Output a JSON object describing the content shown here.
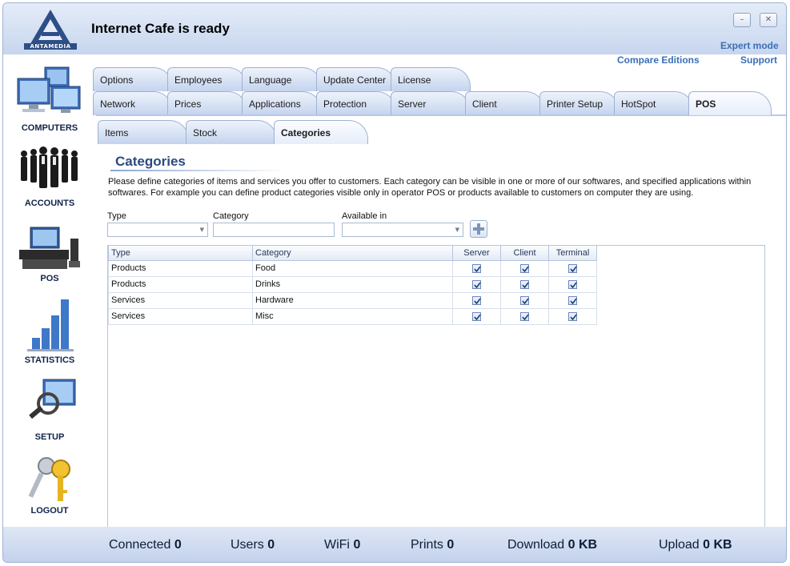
{
  "window": {
    "title": "Internet Cafe is ready",
    "logo_text": "ANTAMEDIA",
    "minimize_glyph": "–",
    "close_glyph": "✕"
  },
  "top_links": {
    "expert_mode": "Expert mode",
    "compare_editions": "Compare Editions",
    "support": "Support"
  },
  "sidebar": {
    "items": [
      {
        "label": "COMPUTERS",
        "icon": "computers-icon"
      },
      {
        "label": "ACCOUNTS",
        "icon": "accounts-icon"
      },
      {
        "label": "POS",
        "icon": "pos-icon"
      },
      {
        "label": "STATISTICS",
        "icon": "statistics-icon"
      },
      {
        "label": "SETUP",
        "icon": "setup-icon"
      },
      {
        "label": "LOGOUT",
        "icon": "logout-icon"
      }
    ]
  },
  "tabs": {
    "row1": [
      "Options",
      "Employees",
      "Language",
      "Update Center",
      "License"
    ],
    "row2": [
      "Network",
      "Prices",
      "Applications",
      "Protection",
      "Server",
      "Client",
      "Printer Setup",
      "HotSpot",
      "POS"
    ],
    "row2_active": "POS",
    "subtabs": [
      "Items",
      "Stock",
      "Categories"
    ],
    "subtab_active": "Categories"
  },
  "categories": {
    "title": "Categories",
    "description": "Please define categories of items and services you offer to customers. Each category can be visible in one or more of our softwares, and specified applications within softwares. For example you can define product categories visible only in operator POS or products available to customers on computer they are using.",
    "form": {
      "type_label": "Type",
      "type_value": "",
      "category_label": "Category",
      "category_value": "",
      "available_label": "Available in",
      "available_value": ""
    },
    "grid": {
      "columns": [
        "Type",
        "Category",
        "Server",
        "Client",
        "Terminal"
      ],
      "rows": [
        {
          "type": "Products",
          "category": "Food",
          "server": true,
          "client": true,
          "terminal": true
        },
        {
          "type": "Products",
          "category": "Drinks",
          "server": true,
          "client": true,
          "terminal": true
        },
        {
          "type": "Services",
          "category": "Hardware",
          "server": true,
          "client": true,
          "terminal": true
        },
        {
          "type": "Services",
          "category": "Misc",
          "server": true,
          "client": true,
          "terminal": true
        }
      ]
    }
  },
  "status": {
    "connected_label": "Connected",
    "connected_value": "0",
    "users_label": "Users",
    "users_value": "0",
    "wifi_label": "WiFi",
    "wifi_value": "0",
    "prints_label": "Prints",
    "prints_value": "0",
    "download_label": "Download",
    "download_value": "0 KB",
    "upload_label": "Upload",
    "upload_value": "0 KB"
  }
}
